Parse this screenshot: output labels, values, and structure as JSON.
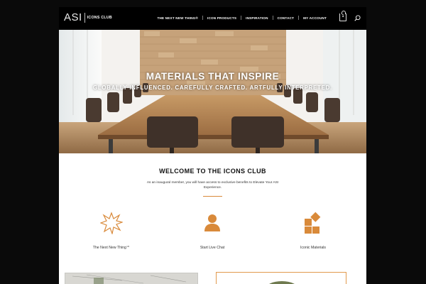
{
  "brand": {
    "asi": "ASI",
    "club": "ICONS CLUB"
  },
  "nav": [
    {
      "label": "THE NEXT NEW THING®"
    },
    {
      "label": "ICON PRODUCTS"
    },
    {
      "label": "INSPIRATION"
    },
    {
      "label": "CONTACT"
    },
    {
      "label": "MY ACCOUNT"
    }
  ],
  "cart": {
    "count": "1"
  },
  "hero": {
    "title": "MATERIALS THAT INSPIRE",
    "subtitle": "GLOBALLY INFLUENCED. CAREFULLY CRAFTED. ARTFULLY INTERPRETED."
  },
  "welcome": {
    "title": "WELCOME TO THE ICONS CLUB",
    "text": "As an inaugural member, you will have access to exclusive benefits to Elevate Your ASI Experience."
  },
  "features": [
    {
      "label": "The Next New Thing℠",
      "icon": "starburst-icon"
    },
    {
      "label": "Start Live Chat",
      "icon": "person-icon"
    },
    {
      "label": "Iconic Materials",
      "icon": "tiles-icon"
    }
  ],
  "colors": {
    "accent": "#d98a3a",
    "header": "#000000",
    "background": "#0a0a0a"
  }
}
